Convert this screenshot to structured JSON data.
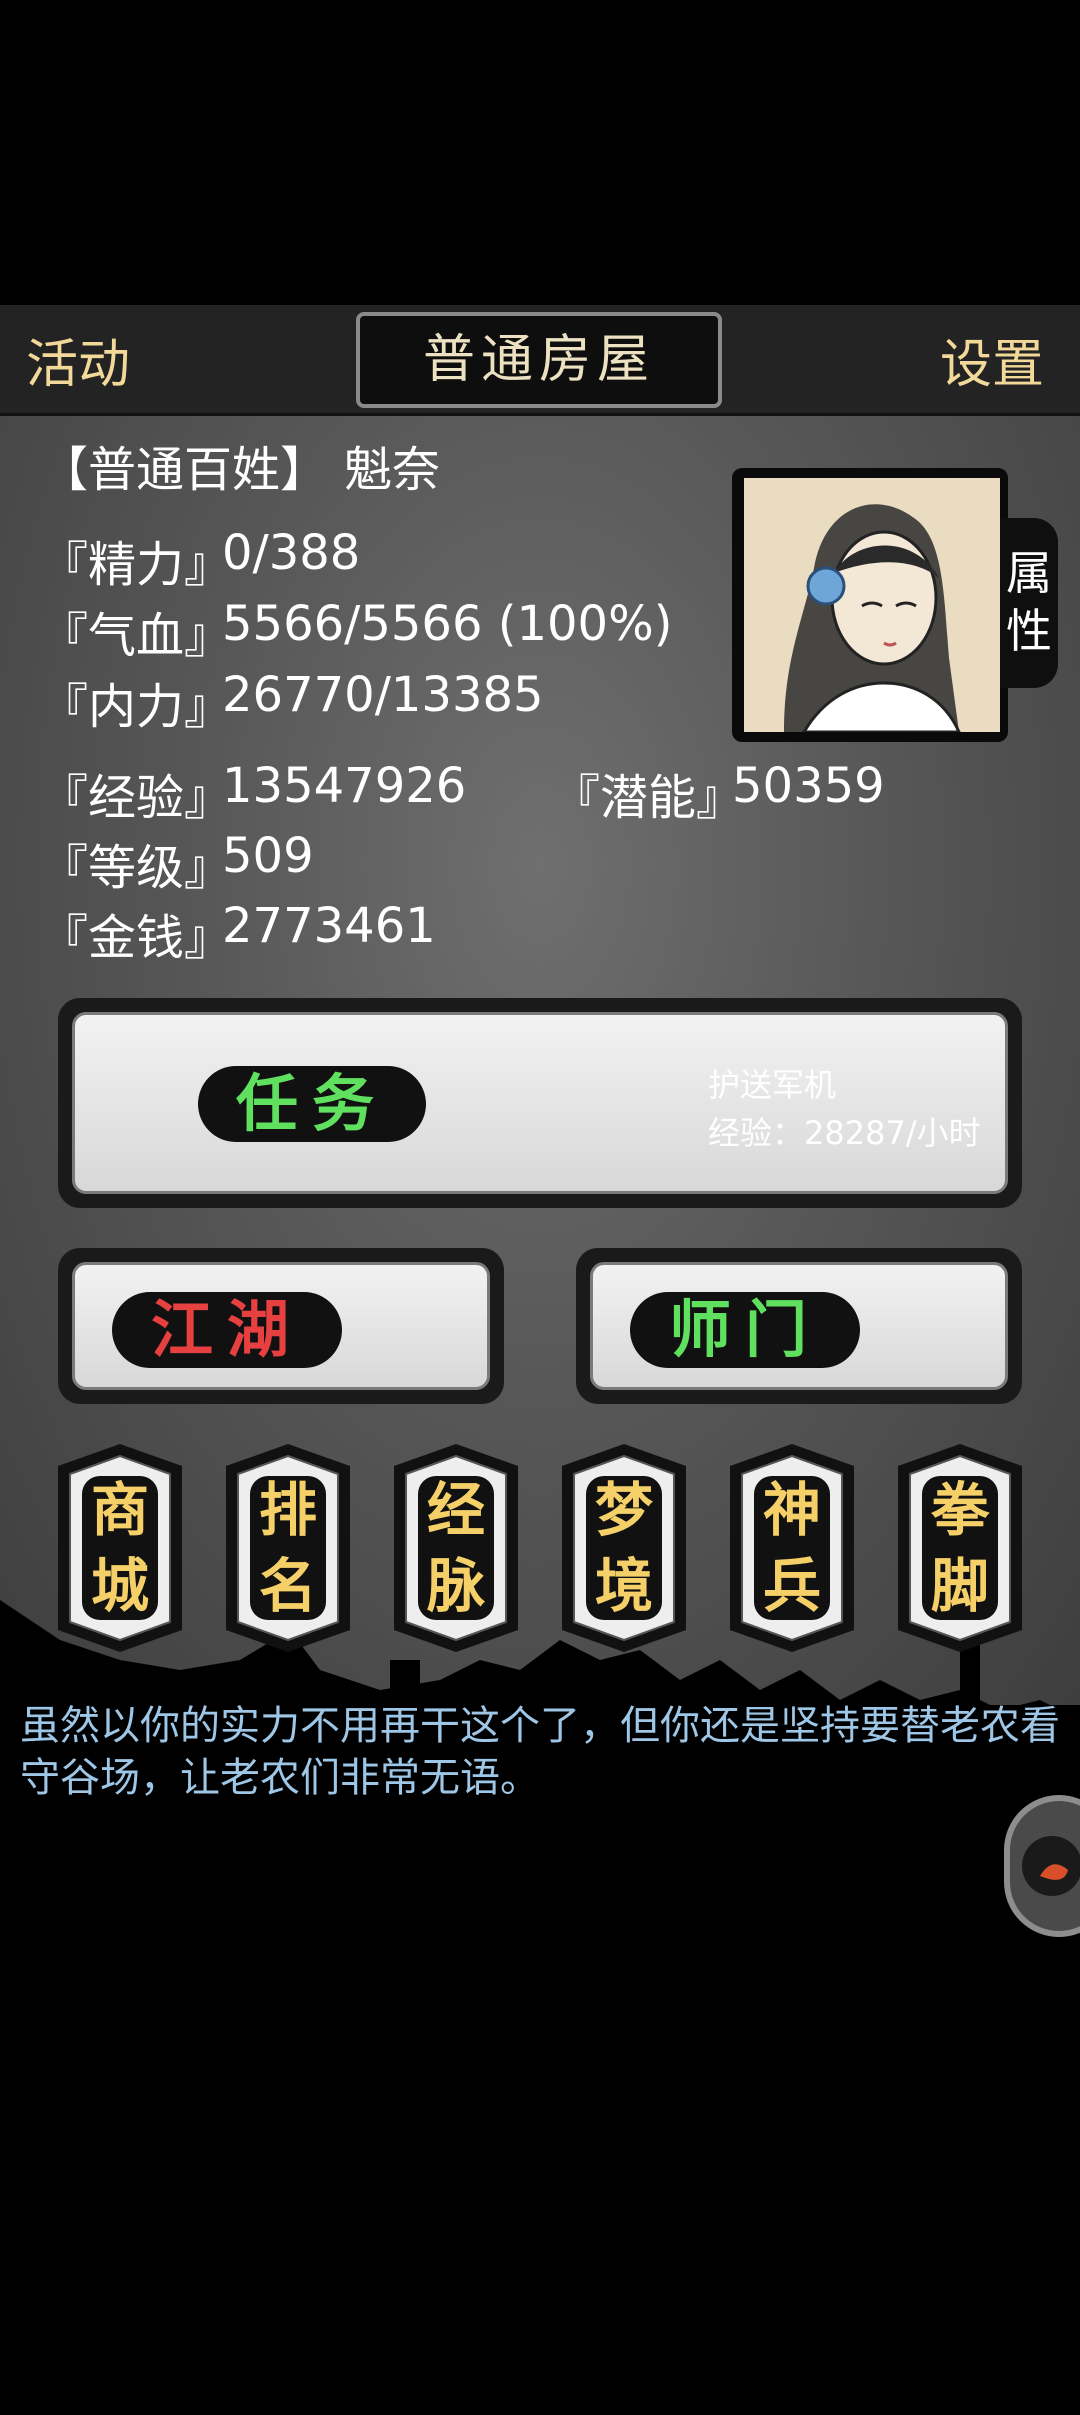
{
  "topbar": {
    "left_label": "活动",
    "title": "普通房屋",
    "right_label": "设置"
  },
  "profile": {
    "rank": "【普通百姓】",
    "name": "魁奈",
    "stats": [
      {
        "label": "『精力』",
        "value": "0/388"
      },
      {
        "label": "『气血』",
        "value": "5566/5566 (100%)"
      },
      {
        "label": "『内力』",
        "value": "26770/13385"
      }
    ],
    "exp_label": "『经验』",
    "exp_value": "13547926",
    "potential_label": "『潜能』",
    "potential_value": "50359",
    "level_label": "『等级』",
    "level_value": "509",
    "money_label": "『金钱』",
    "money_value": "2773461",
    "attr_tab": "属性"
  },
  "task": {
    "label": "任务",
    "name": "护送军机",
    "exp_rate": "经验：28287/小时"
  },
  "buttons": {
    "jianghu": "江湖",
    "shimen": "师门"
  },
  "shortcuts": [
    {
      "top": "商",
      "bottom": "城"
    },
    {
      "top": "排",
      "bottom": "名"
    },
    {
      "top": "经",
      "bottom": "脉"
    },
    {
      "top": "梦",
      "bottom": "境"
    },
    {
      "top": "神",
      "bottom": "兵"
    },
    {
      "top": "拳",
      "bottom": "脚"
    }
  ],
  "message": "虽然以你的实力不用再干这个了，但你还是坚持要替老农看守谷场，让老农们非常无语。",
  "colors": {
    "gold": "#f2d99a",
    "green": "#5fe05f",
    "red": "#e64040",
    "message": "#9ec6e6"
  }
}
